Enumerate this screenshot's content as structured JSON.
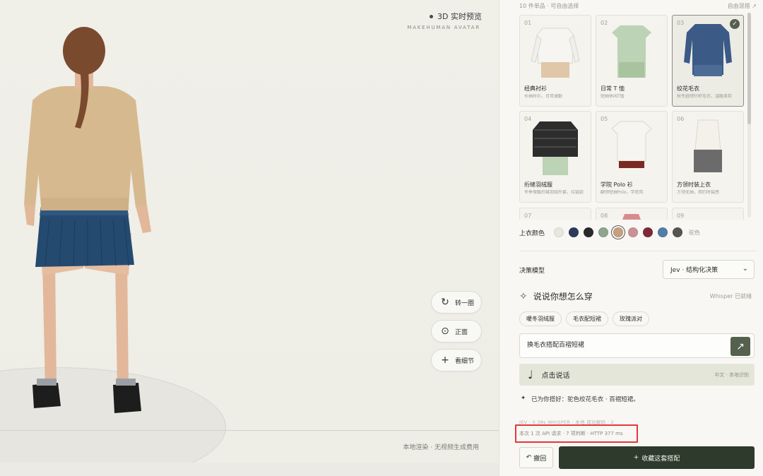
{
  "viewport": {
    "preview_label": "3D 实时预览",
    "avatar_subtitle": "MAKEHUMAN AVATAR",
    "render_note": "本地渲染 · 无视频生成费用",
    "camera_buttons": [
      {
        "icon": "rotate-icon",
        "label": "转一圈"
      },
      {
        "icon": "front-view-icon",
        "label": "正面"
      },
      {
        "icon": "zoom-detail-icon",
        "label": "看细节"
      }
    ]
  },
  "panel": {
    "count_label": "10 件单品 · 可自由选择",
    "free_mix_link": "自由混搭 ↗",
    "items": [
      {
        "num": "01",
        "name": "经典衬衫",
        "desc": "长袖衬衫，日常通勤",
        "selected": false
      },
      {
        "num": "02",
        "name": "日常 T 恤",
        "desc": "短袖休闲T恤",
        "selected": false
      },
      {
        "num": "03",
        "name": "绞花毛衣",
        "desc": "秋冬圆领针织毛衣，温暖柔软",
        "selected": true
      },
      {
        "num": "04",
        "name": "绗缝羽绒服",
        "desc": "冬季保暖绗缝羽绒外套，拉链款",
        "selected": false
      },
      {
        "num": "05",
        "name": "学院 Polo 衫",
        "desc": "翻领短袖Polo，学院风",
        "selected": false
      },
      {
        "num": "06",
        "name": "方领时装上衣",
        "desc": "方领无袖，简约时装感",
        "selected": false
      },
      {
        "num": "07",
        "name": "",
        "desc": "",
        "selected": false
      },
      {
        "num": "08",
        "name": "",
        "desc": "",
        "selected": false
      },
      {
        "num": "09",
        "name": "",
        "desc": "",
        "selected": false
      }
    ],
    "selected_check": "✓",
    "top_color_label": "上衣颜色",
    "selected_color_name": "驼色",
    "colors": [
      "#e8e7dd",
      "#2e3a5c",
      "#2a2a2a",
      "#8fa58e",
      "#c4a07c",
      "#c79297",
      "#7c2a3a",
      "#4f7fa8",
      "#555555"
    ],
    "selected_color_index": 4,
    "model_label": "决策模型",
    "model_value": "Jev · 结构化决策",
    "speak_title": "说说你想怎么穿",
    "whisper_status": "Whisper 已就绪",
    "quick_chips": [
      "暖冬羽绒服",
      "毛衣配短裙",
      "玫瑰派对"
    ],
    "input_value": "换毛衣搭配百褶短裙",
    "voice_label": "点击说话",
    "voice_hint": "中文 · 本地识别",
    "status_prefix": "✦",
    "status_text": "已为你搭好：驼色绞花毛衣 · 百褶短裙。",
    "meta_line": "JEV · 0.38s     WHISPER · 本地     成功解码 · 2",
    "api_line": "本次 1 次 API 请求 · 7 项判断 · HTTP 377 ms",
    "undo_label": "撤回",
    "save_label": "收藏这套搭配"
  }
}
